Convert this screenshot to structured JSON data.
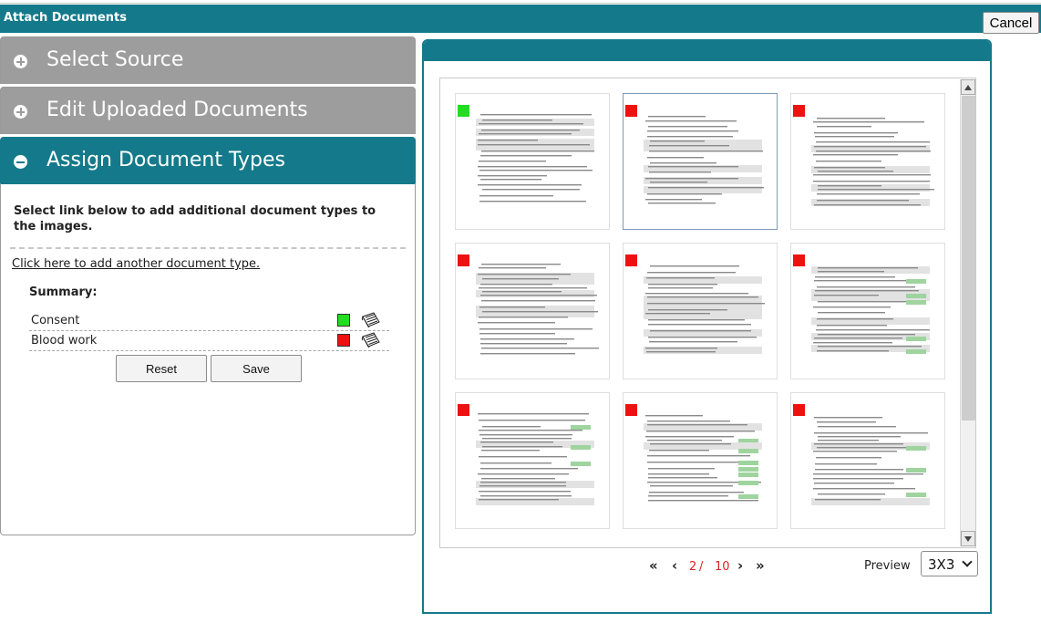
{
  "window": {
    "title": "Attach Documents",
    "cancel_label": "Cancel"
  },
  "accordion": [
    {
      "label": "Select Source",
      "state": "collapsed"
    },
    {
      "label": "Edit Uploaded Documents",
      "state": "collapsed"
    },
    {
      "label": "Assign Document Types",
      "state": "expanded"
    }
  ],
  "assign": {
    "instruction": "Select link below to add additional document types to the images.",
    "add_link": "Click here to add another document type.",
    "summary_label": "Summary:",
    "types": [
      {
        "name": "Consent",
        "color": "#22dd22"
      },
      {
        "name": "Blood work",
        "color": "#ee1111"
      }
    ],
    "reset_label": "Reset",
    "save_label": "Save"
  },
  "thumbnails": [
    {
      "marker_color": "#22dd22",
      "selected": false
    },
    {
      "marker_color": "#ee1111",
      "selected": true
    },
    {
      "marker_color": "#ee1111",
      "selected": false
    },
    {
      "marker_color": "#ee1111",
      "selected": false
    },
    {
      "marker_color": "#ee1111",
      "selected": false
    },
    {
      "marker_color": "#ee1111",
      "selected": false
    },
    {
      "marker_color": "#ee1111",
      "selected": false
    },
    {
      "marker_color": "#ee1111",
      "selected": false
    },
    {
      "marker_color": "#ee1111",
      "selected": false
    }
  ],
  "pager": {
    "first": "«",
    "prev": "‹",
    "current": "2",
    "separator": "/",
    "total": "10",
    "next": "›",
    "last": "»"
  },
  "preview": {
    "label": "Preview",
    "selected": "3X3"
  },
  "colors": {
    "accent": "#147a8b",
    "collapsed_header": "#9d9d9d"
  },
  "icons": {
    "expand": "plus-circle-icon",
    "collapse": "minus-circle-icon",
    "edit": "notepad-icon"
  }
}
